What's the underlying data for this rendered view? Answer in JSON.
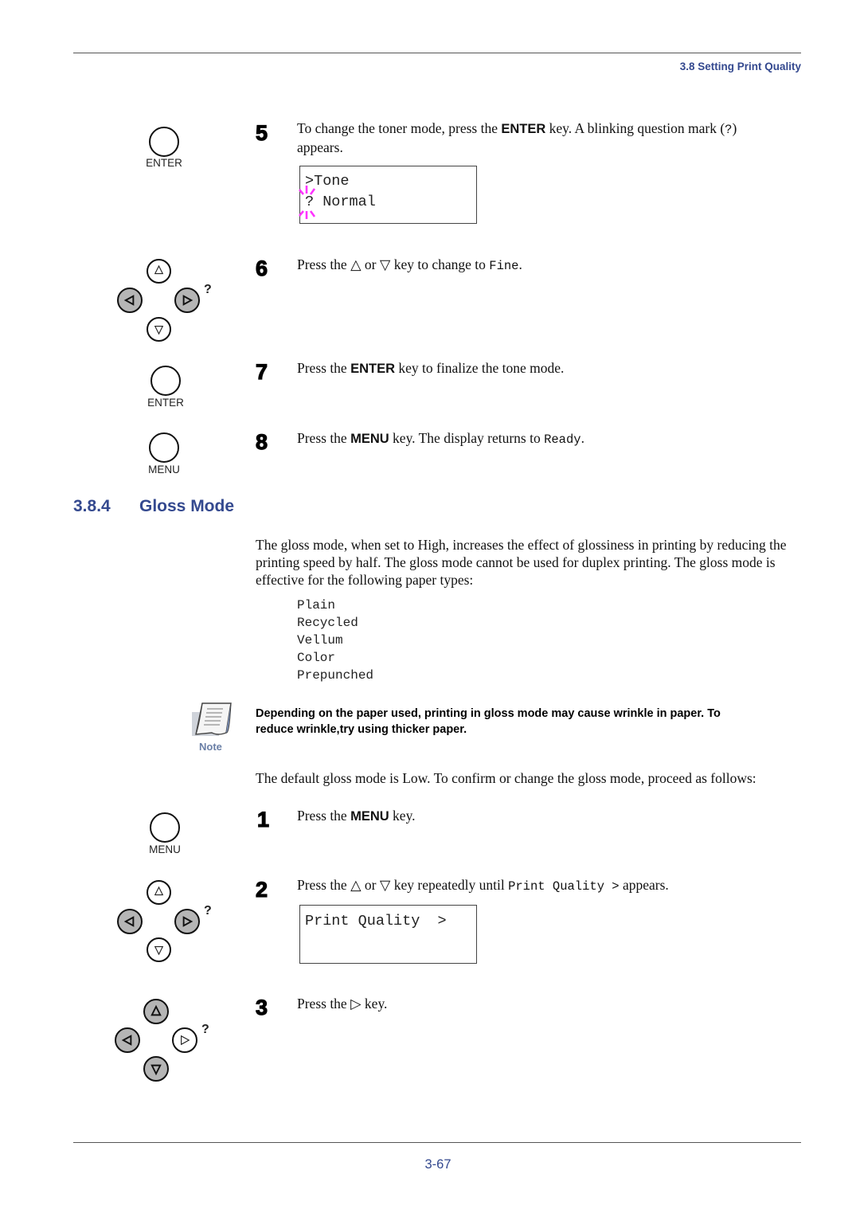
{
  "header": {
    "section_title": "3.8 Setting Print Quality"
  },
  "steps_top": [
    {
      "number": "5",
      "text_before": "To change the toner mode, press the ",
      "key": "ENTER",
      "text_after": " key. A blinking question mark (",
      "mono": "?",
      "text_end": ")",
      "text_line2": "appears.",
      "lcd": {
        "line1": ">Tone",
        "line2": "? Normal"
      },
      "button": {
        "label": "ENTER"
      }
    },
    {
      "number": "6",
      "text_before": "Press the ",
      "up_glyph": "△",
      "or": " or ",
      "down_glyph": "▽",
      "text_after": " key to change to ",
      "mono": "Fine",
      "text_end": "."
    },
    {
      "number": "7",
      "text_before": "Press the ",
      "key": "ENTER",
      "text_after": " key to finalize the tone mode.",
      "button": {
        "label": "ENTER"
      }
    },
    {
      "number": "8",
      "text_before": "Press the ",
      "key": "MENU",
      "text_after": " key. The display returns to ",
      "mono": "Ready",
      "text_end": ".",
      "button": {
        "label": "MENU"
      }
    }
  ],
  "section": {
    "number": "3.8.4",
    "title": "Gloss Mode",
    "intro_lines": [
      "The gloss mode, when set to High, increases the effect of glossiness in printing by reducing the",
      "printing speed by half. The gloss mode cannot be used for duplex printing. The gloss mode is",
      "effective for the following paper types:"
    ],
    "paper_types": [
      "Plain",
      "Recycled",
      "Vellum",
      "Color",
      "Prepunched"
    ],
    "note": {
      "label": "Note",
      "lines": [
        "Depending on the paper used, printing in gloss mode may cause wrinkle in paper. To",
        "reduce wrinkle,try using thicker paper."
      ]
    },
    "default_text": "The default gloss mode is Low. To confirm or change the gloss mode, proceed as follows:"
  },
  "steps_bottom": [
    {
      "number": "1",
      "text_before": "Press the ",
      "key": "MENU",
      "text_after": " key.",
      "button": {
        "label": "MENU"
      }
    },
    {
      "number": "2",
      "text_before": "Press the ",
      "up_glyph": "△",
      "or": " or ",
      "down_glyph": "▽",
      "text_after": " key repeatedly until ",
      "mono": "Print Quality >",
      "text_end": " appears.",
      "lcd": {
        "line1": "Print Quality  >",
        "line2": ""
      }
    },
    {
      "number": "3",
      "text_before": "Press the ",
      "right_glyph": "▷",
      "text_after": " key."
    }
  ],
  "keypad": {
    "question_mark": "?"
  },
  "footer": {
    "page_number": "3-67"
  },
  "colors": {
    "accent": "#34498f",
    "blink": "#ff33ff",
    "pressed_key": "#b5b5b5"
  }
}
